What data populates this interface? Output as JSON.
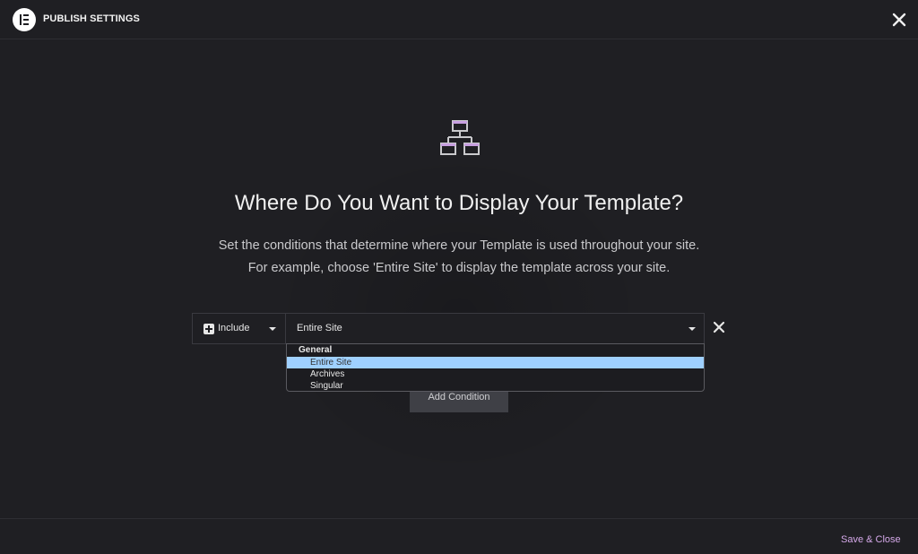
{
  "header": {
    "title": "PUBLISH SETTINGS"
  },
  "main": {
    "heading": "Where Do You Want to Display Your Template?",
    "description_line1": "Set the conditions that determine where your Template is used throughout your site.",
    "description_line2": "For example, choose 'Entire Site' to display the template across your site."
  },
  "condition": {
    "type_label": "Include",
    "selected_value": "Entire Site",
    "dropdown": {
      "group_label": "General",
      "options": [
        "Entire Site",
        "Archives",
        "Singular"
      ],
      "selected_index": 0
    }
  },
  "add_condition_label": "Add Condition",
  "footer": {
    "save_close_label": "Save & Close"
  },
  "colors": {
    "background": "#1f1f23",
    "accent": "#d4a8e8",
    "selected_option": "#9fd0ff",
    "icon_accent": "#c79fe0"
  },
  "icons": [
    "elementor-logo-icon",
    "close-icon",
    "sitemap-icon",
    "plus-square-icon",
    "chevron-down-icon",
    "remove-condition-icon"
  ]
}
